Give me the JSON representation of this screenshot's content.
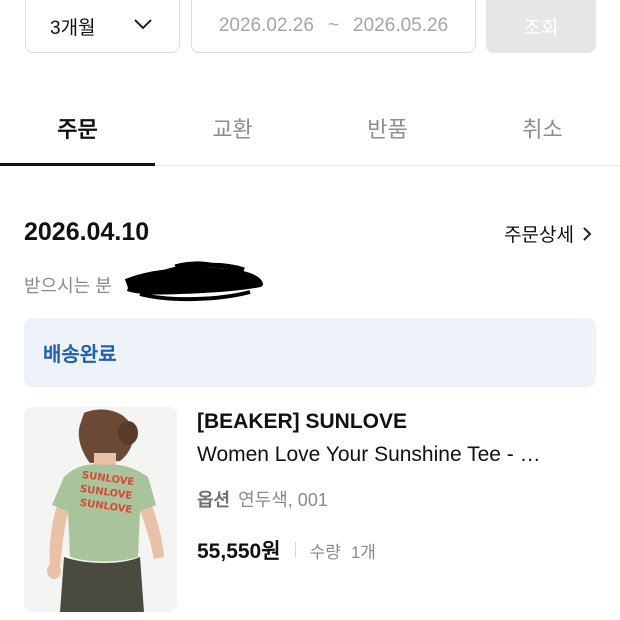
{
  "filter": {
    "period": "3개월",
    "date_start": "2026.02.26",
    "date_sep": "~",
    "date_end": "2026.05.26",
    "search_label": "조회"
  },
  "tabs": [
    {
      "label": "주문",
      "active": true
    },
    {
      "label": "교환",
      "active": false
    },
    {
      "label": "반품",
      "active": false
    },
    {
      "label": "취소",
      "active": false
    }
  ],
  "order": {
    "date": "2026.04.10",
    "detail_link": "주문상세",
    "recipient_label": "받으시는 분",
    "status": "배송완료"
  },
  "product": {
    "brand": "[BEAKER] SUNLOVE",
    "title": "Women Love Your Sunshine Tee - …",
    "option_label": "옵션",
    "option_value": "연두색, 001",
    "price": "55,550원",
    "qty_label": "수량",
    "qty_value": "1개",
    "shirt_print": [
      "SUNLOVE",
      "SUNLOVE",
      "SUNLOVE"
    ]
  },
  "colors": {
    "status_text": "#1f5eb5",
    "status_bg": "#eef3f9",
    "search_button_bg": "#e6e6e6",
    "tee": "#a9c49a",
    "print": "#d9463a"
  },
  "icons": {
    "period_select": "chevron-down-icon",
    "detail_link": "chevron-right-icon"
  }
}
